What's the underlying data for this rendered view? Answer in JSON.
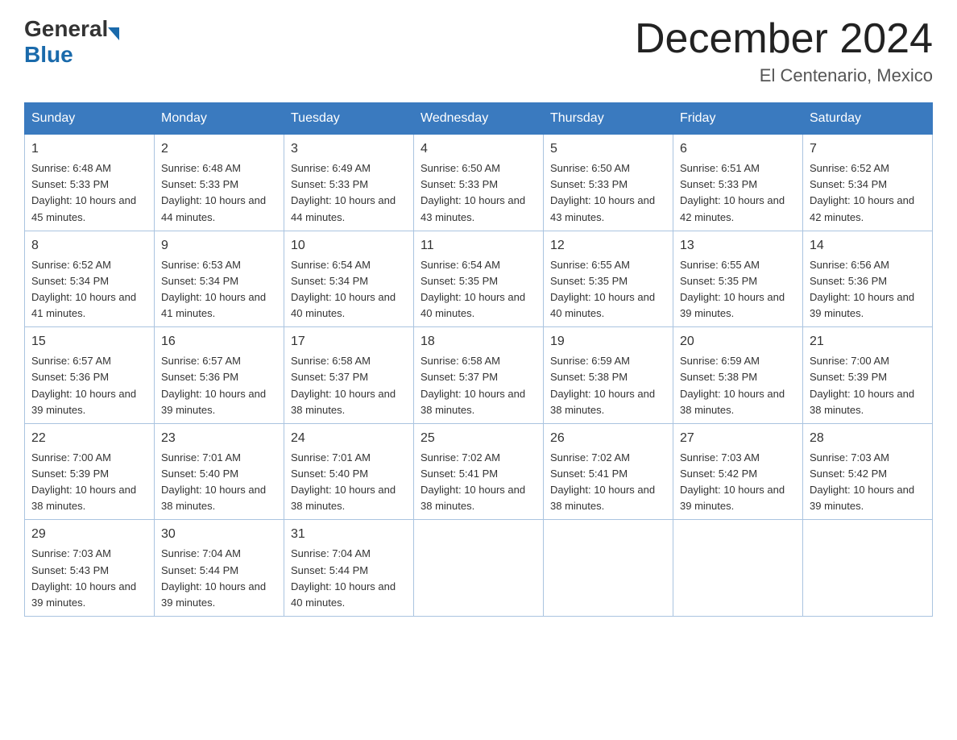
{
  "header": {
    "logo_general": "General",
    "logo_blue": "Blue",
    "month_title": "December 2024",
    "location": "El Centenario, Mexico"
  },
  "weekdays": [
    "Sunday",
    "Monday",
    "Tuesday",
    "Wednesday",
    "Thursday",
    "Friday",
    "Saturday"
  ],
  "weeks": [
    [
      {
        "num": "1",
        "sunrise": "6:48 AM",
        "sunset": "5:33 PM",
        "daylight": "10 hours and 45 minutes."
      },
      {
        "num": "2",
        "sunrise": "6:48 AM",
        "sunset": "5:33 PM",
        "daylight": "10 hours and 44 minutes."
      },
      {
        "num": "3",
        "sunrise": "6:49 AM",
        "sunset": "5:33 PM",
        "daylight": "10 hours and 44 minutes."
      },
      {
        "num": "4",
        "sunrise": "6:50 AM",
        "sunset": "5:33 PM",
        "daylight": "10 hours and 43 minutes."
      },
      {
        "num": "5",
        "sunrise": "6:50 AM",
        "sunset": "5:33 PM",
        "daylight": "10 hours and 43 minutes."
      },
      {
        "num": "6",
        "sunrise": "6:51 AM",
        "sunset": "5:33 PM",
        "daylight": "10 hours and 42 minutes."
      },
      {
        "num": "7",
        "sunrise": "6:52 AM",
        "sunset": "5:34 PM",
        "daylight": "10 hours and 42 minutes."
      }
    ],
    [
      {
        "num": "8",
        "sunrise": "6:52 AM",
        "sunset": "5:34 PM",
        "daylight": "10 hours and 41 minutes."
      },
      {
        "num": "9",
        "sunrise": "6:53 AM",
        "sunset": "5:34 PM",
        "daylight": "10 hours and 41 minutes."
      },
      {
        "num": "10",
        "sunrise": "6:54 AM",
        "sunset": "5:34 PM",
        "daylight": "10 hours and 40 minutes."
      },
      {
        "num": "11",
        "sunrise": "6:54 AM",
        "sunset": "5:35 PM",
        "daylight": "10 hours and 40 minutes."
      },
      {
        "num": "12",
        "sunrise": "6:55 AM",
        "sunset": "5:35 PM",
        "daylight": "10 hours and 40 minutes."
      },
      {
        "num": "13",
        "sunrise": "6:55 AM",
        "sunset": "5:35 PM",
        "daylight": "10 hours and 39 minutes."
      },
      {
        "num": "14",
        "sunrise": "6:56 AM",
        "sunset": "5:36 PM",
        "daylight": "10 hours and 39 minutes."
      }
    ],
    [
      {
        "num": "15",
        "sunrise": "6:57 AM",
        "sunset": "5:36 PM",
        "daylight": "10 hours and 39 minutes."
      },
      {
        "num": "16",
        "sunrise": "6:57 AM",
        "sunset": "5:36 PM",
        "daylight": "10 hours and 39 minutes."
      },
      {
        "num": "17",
        "sunrise": "6:58 AM",
        "sunset": "5:37 PM",
        "daylight": "10 hours and 38 minutes."
      },
      {
        "num": "18",
        "sunrise": "6:58 AM",
        "sunset": "5:37 PM",
        "daylight": "10 hours and 38 minutes."
      },
      {
        "num": "19",
        "sunrise": "6:59 AM",
        "sunset": "5:38 PM",
        "daylight": "10 hours and 38 minutes."
      },
      {
        "num": "20",
        "sunrise": "6:59 AM",
        "sunset": "5:38 PM",
        "daylight": "10 hours and 38 minutes."
      },
      {
        "num": "21",
        "sunrise": "7:00 AM",
        "sunset": "5:39 PM",
        "daylight": "10 hours and 38 minutes."
      }
    ],
    [
      {
        "num": "22",
        "sunrise": "7:00 AM",
        "sunset": "5:39 PM",
        "daylight": "10 hours and 38 minutes."
      },
      {
        "num": "23",
        "sunrise": "7:01 AM",
        "sunset": "5:40 PM",
        "daylight": "10 hours and 38 minutes."
      },
      {
        "num": "24",
        "sunrise": "7:01 AM",
        "sunset": "5:40 PM",
        "daylight": "10 hours and 38 minutes."
      },
      {
        "num": "25",
        "sunrise": "7:02 AM",
        "sunset": "5:41 PM",
        "daylight": "10 hours and 38 minutes."
      },
      {
        "num": "26",
        "sunrise": "7:02 AM",
        "sunset": "5:41 PM",
        "daylight": "10 hours and 38 minutes."
      },
      {
        "num": "27",
        "sunrise": "7:03 AM",
        "sunset": "5:42 PM",
        "daylight": "10 hours and 39 minutes."
      },
      {
        "num": "28",
        "sunrise": "7:03 AM",
        "sunset": "5:42 PM",
        "daylight": "10 hours and 39 minutes."
      }
    ],
    [
      {
        "num": "29",
        "sunrise": "7:03 AM",
        "sunset": "5:43 PM",
        "daylight": "10 hours and 39 minutes."
      },
      {
        "num": "30",
        "sunrise": "7:04 AM",
        "sunset": "5:44 PM",
        "daylight": "10 hours and 39 minutes."
      },
      {
        "num": "31",
        "sunrise": "7:04 AM",
        "sunset": "5:44 PM",
        "daylight": "10 hours and 40 minutes."
      },
      null,
      null,
      null,
      null
    ]
  ]
}
